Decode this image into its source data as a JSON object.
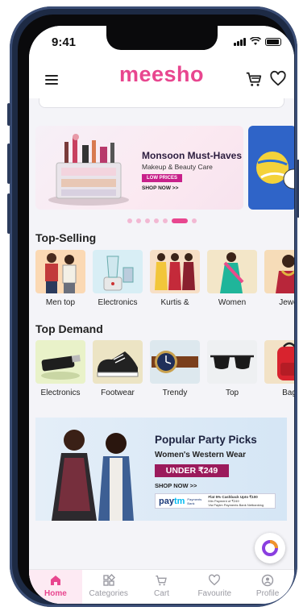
{
  "status_bar": {
    "time": "9:41"
  },
  "header": {
    "logo": "meesho"
  },
  "carousel": {
    "banner": {
      "title": "Monsoon Must-Haves",
      "subtitle": "Makeup & Beauty Care",
      "badge": "LOW PRICES",
      "cta": "SHOP NOW >>"
    },
    "dot_count": 7,
    "active_dot": 5
  },
  "top_selling": {
    "title": "Top-Selling",
    "items": [
      {
        "label": "Men top",
        "icon": "men-top-image"
      },
      {
        "label": "Electronics",
        "icon": "mixer-grinder-image"
      },
      {
        "label": "Kurtis &",
        "icon": "kurtis-image"
      },
      {
        "label": "Women",
        "icon": "saree-image"
      },
      {
        "label": "Jewel",
        "icon": "jewellery-image"
      }
    ]
  },
  "top_demand": {
    "title": "Top Demand",
    "items": [
      {
        "label": "Electronics",
        "icon": "usb-drive-image"
      },
      {
        "label": "Footwear",
        "icon": "sneaker-image"
      },
      {
        "label": "Trendy",
        "icon": "watch-image"
      },
      {
        "label": "Top",
        "icon": "sunglasses-image"
      },
      {
        "label": "Bag",
        "icon": "backpack-image"
      }
    ]
  },
  "promo_banner": {
    "title": "Popular Party Picks",
    "subtitle": "Women's Western Wear",
    "price_tag": "UNDER ₹249",
    "cta": "SHOP NOW >>",
    "paytm_logo_pay": "pay",
    "paytm_logo_tm": "tm",
    "paytm_bank": "Payments Bank",
    "paytm_offer": "Flat 5% Cashback Upto ₹100",
    "paytm_fine_1": "Min Payment of ₹249",
    "paytm_fine_2": "Via Paytm Payments Bank Netbanking"
  },
  "bottom_nav": [
    {
      "label": "Home",
      "icon": "home-icon",
      "active": true
    },
    {
      "label": "Categories",
      "icon": "categories-icon",
      "active": false
    },
    {
      "label": "Cart",
      "icon": "cart-icon",
      "active": false
    },
    {
      "label": "Favourite",
      "icon": "heart-icon",
      "active": false
    },
    {
      "label": "Profile",
      "icon": "profile-icon",
      "active": false
    }
  ],
  "colors": {
    "brand": "#e8468f",
    "promo_price": "#9b1b5c",
    "frame": "#1d2a44"
  }
}
